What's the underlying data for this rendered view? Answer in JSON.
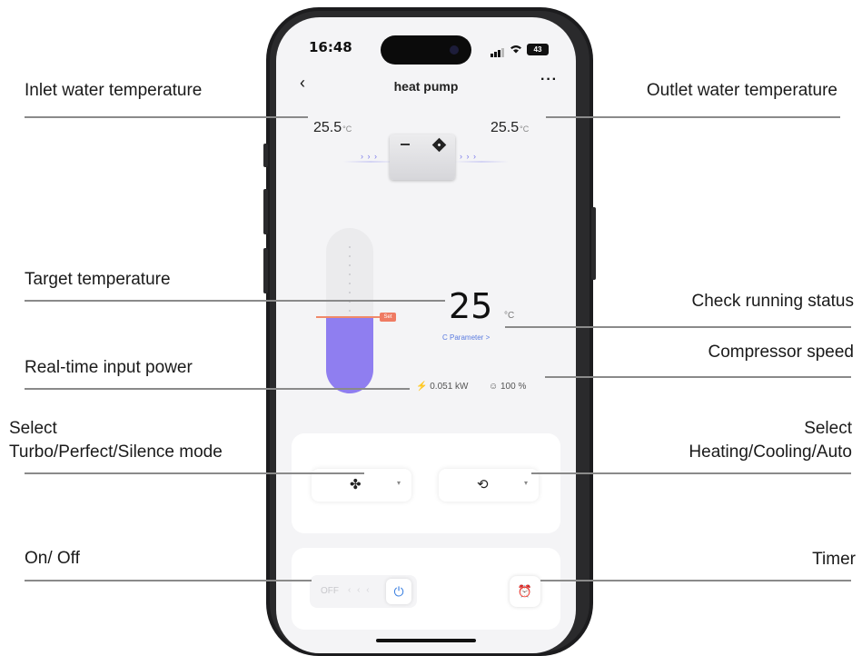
{
  "callouts": {
    "inlet": "Inlet water temperature",
    "outlet": "Outlet water temperature",
    "target": "Target temperature",
    "check_status": "Check running status",
    "compressor": "Compressor speed",
    "input_power": "Real-time input power",
    "select_mode_line1": "Select",
    "select_mode_line2": "Turbo/Perfect/Silence mode",
    "select_hc_line1": "Select",
    "select_hc_line2": "Heating/Cooling/Auto",
    "on_off": "On/ Off",
    "timer": "Timer"
  },
  "status_bar": {
    "time": "16:48",
    "battery": "43"
  },
  "nav": {
    "back": "‹",
    "title": "heat pump",
    "more": "···"
  },
  "temperatures": {
    "inlet": "25.5",
    "outlet": "25.5",
    "unit": "°C"
  },
  "flow": {
    "left": "› › ›",
    "right": "› › ›"
  },
  "thermometer": {
    "set_tag": "Set",
    "fill_percent": 46
  },
  "target": {
    "value": "25",
    "unit": "°C"
  },
  "parameter_link": "C Parameter >",
  "readings": {
    "power": "0.051 kW",
    "speed": "100 %"
  },
  "controls": {
    "turbo_icon": "fan-icon",
    "mode_icon": "auto-mode-icon",
    "dropdown_caret": "▾",
    "off_label": "OFF",
    "slide_chevrons": "‹ ‹ ‹",
    "power_icon": "⏻",
    "timer_icon": "⏰"
  },
  "colors": {
    "accent_purple": "#8f7ef0",
    "set_tag": "#ef7b63",
    "link_blue": "#5a7be0",
    "power_blue": "#3a7fe0"
  }
}
